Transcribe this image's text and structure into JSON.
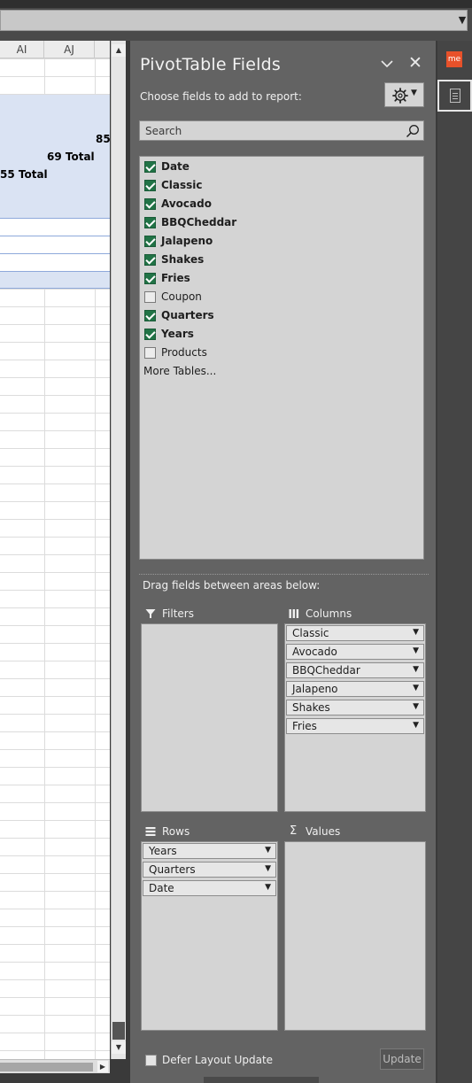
{
  "sheet": {
    "columns": [
      "AI",
      "AJ"
    ],
    "cells": {
      "c1": "85",
      "c2": "69 Total",
      "c3": "55 Total"
    }
  },
  "pane": {
    "title": "PivotTable Fields",
    "choose_text": "Choose fields to add to report:",
    "search_placeholder": "Search",
    "fields": [
      {
        "label": "Date",
        "checked": true
      },
      {
        "label": "Classic",
        "checked": true
      },
      {
        "label": "Avocado",
        "checked": true
      },
      {
        "label": "BBQCheddar",
        "checked": true
      },
      {
        "label": "Jalapeno",
        "checked": true
      },
      {
        "label": "Shakes",
        "checked": true
      },
      {
        "label": "Fries",
        "checked": true
      },
      {
        "label": "Coupon",
        "checked": false
      },
      {
        "label": "Quarters",
        "checked": true
      },
      {
        "label": "Years",
        "checked": true
      },
      {
        "label": "Products",
        "checked": false
      }
    ],
    "more_tables": "More Tables...",
    "drag_text": "Drag fields between areas below:",
    "areas": {
      "filters": {
        "label": "Filters",
        "items": []
      },
      "columns": {
        "label": "Columns",
        "items": [
          "Classic",
          "Avocado",
          "BBQCheddar",
          "Jalapeno",
          "Shakes",
          "Fries"
        ]
      },
      "rows": {
        "label": "Rows",
        "items": [
          "Years",
          "Quarters",
          "Date"
        ]
      },
      "values": {
        "label": "Values",
        "items": []
      }
    },
    "defer_label": "Defer Layout Update",
    "update_label": "Update"
  },
  "rail": {
    "app1_label": "me"
  },
  "icons": {
    "chevron": "chevron-down-icon",
    "close": "close-icon",
    "gear": "gear-icon",
    "search": "search-icon",
    "filter": "filter-icon",
    "columns": "columns-icon",
    "rows": "rows-icon",
    "values": "sigma-icon"
  }
}
